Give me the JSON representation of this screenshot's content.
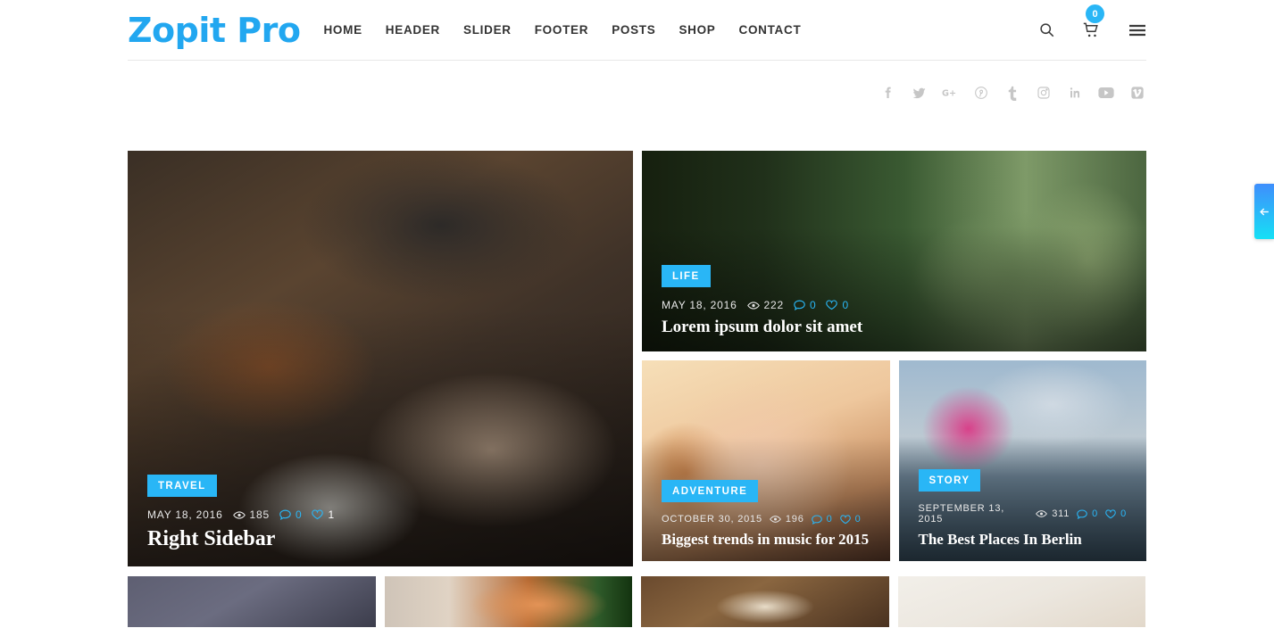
{
  "site": {
    "logo": "Zopit Pro"
  },
  "nav": {
    "items": [
      {
        "label": "HOME"
      },
      {
        "label": "HEADER"
      },
      {
        "label": "SLIDER"
      },
      {
        "label": "FOOTER"
      },
      {
        "label": "POSTS"
      },
      {
        "label": "SHOP"
      },
      {
        "label": "CONTACT"
      }
    ]
  },
  "header_actions": {
    "search_icon": "search-icon",
    "cart_icon": "cart-icon",
    "cart_count": "0",
    "menu_icon": "hamburger-menu-icon"
  },
  "social": {
    "items": [
      {
        "name": "facebook",
        "glyph": "f"
      },
      {
        "name": "twitter",
        "glyph": "✈"
      },
      {
        "name": "google-plus",
        "glyph": "G+"
      },
      {
        "name": "pinterest",
        "glyph": "Ⓟ"
      },
      {
        "name": "tumblr",
        "glyph": "t"
      },
      {
        "name": "instagram",
        "glyph": "▣"
      },
      {
        "name": "linkedin",
        "glyph": "in"
      },
      {
        "name": "youtube",
        "glyph": "▶"
      },
      {
        "name": "vimeo",
        "glyph": "V"
      }
    ]
  },
  "posts": {
    "featured": {
      "category": "TRAVEL",
      "date": "MAY 18, 2016",
      "views": "185",
      "comments": "0",
      "likes": "1",
      "title": "Right Sidebar",
      "image": "desk-laptop-coffee-notebook"
    },
    "wide": {
      "category": "LIFE",
      "date": "MAY 18, 2016",
      "views": "222",
      "comments": "0",
      "likes": "0",
      "title": "Lorem ipsum dolor sit amet",
      "image": "forest-path"
    },
    "half_left": {
      "category": "ADVENTURE",
      "date": "OCTOBER 30, 2015",
      "views": "196",
      "comments": "0",
      "likes": "0",
      "title": "Biggest trends in music for 2015",
      "image": "woman-surprised-face"
    },
    "half_right": {
      "category": "STORY",
      "date": "SEPTEMBER 13, 2015",
      "views": "311",
      "comments": "0",
      "likes": "0",
      "title": "The Best Places In Berlin",
      "image": "woman-bicycle-waterfront"
    },
    "thumbnails": [
      {
        "image": "smartphone-on-grey"
      },
      {
        "image": "woman-playing-violin"
      },
      {
        "image": "coffee-cup-on-wood"
      },
      {
        "image": "pale-portrait"
      }
    ]
  },
  "side_tab": {
    "icon": "arrow-left-icon"
  },
  "colors": {
    "accent": "#29b6f6",
    "logo": "#22a7f0",
    "nav_text": "#333333",
    "social_icon": "#c6c6c6"
  },
  "icons": {
    "eye": "eye-icon",
    "comment": "comment-icon",
    "heart": "heart-icon"
  }
}
